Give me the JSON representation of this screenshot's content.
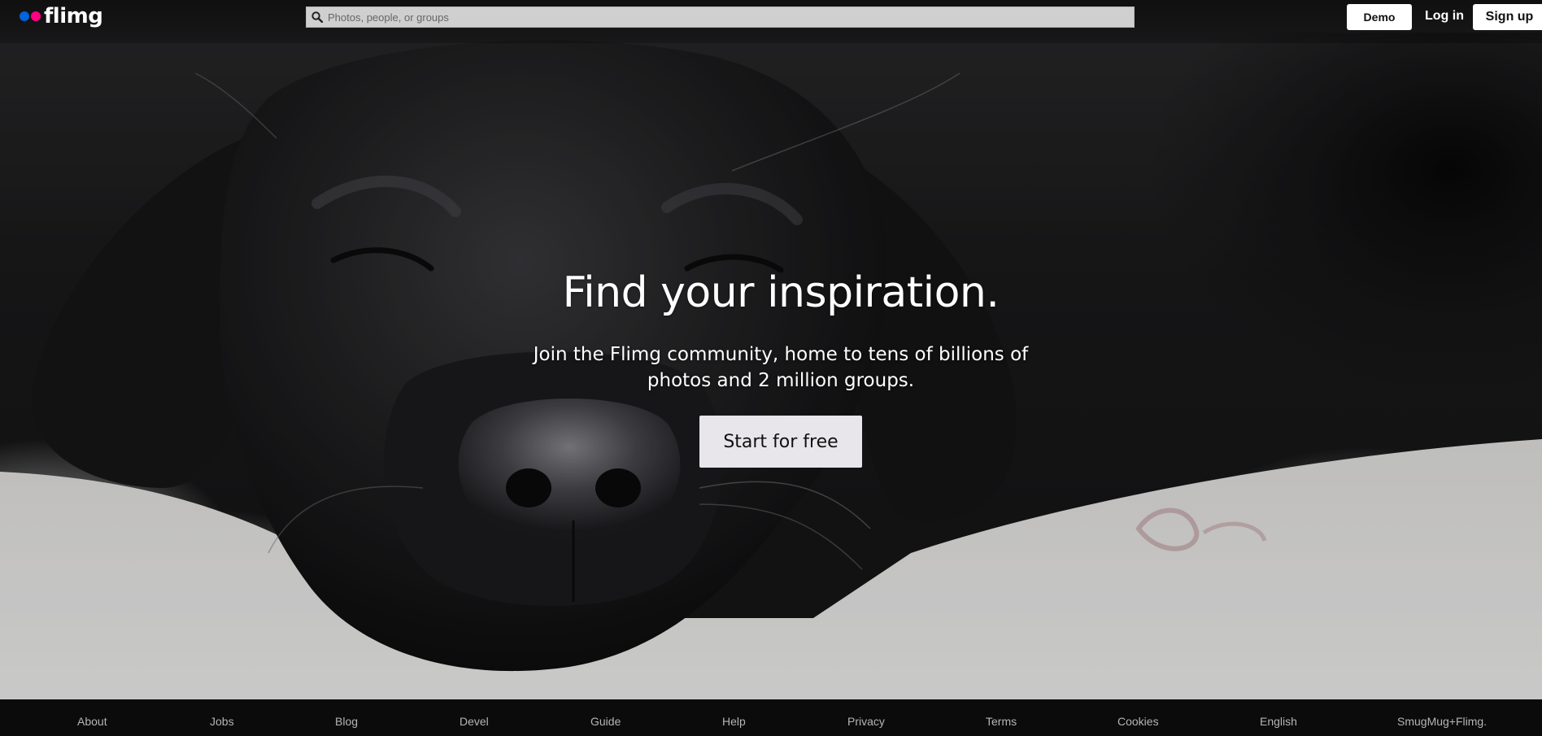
{
  "brand": {
    "name": "flimg",
    "dot_colors": [
      "#0063dc",
      "#ff0084"
    ]
  },
  "search": {
    "placeholder": "Photos, people, or groups",
    "icon": "search-icon"
  },
  "header": {
    "demo_label": "Demo",
    "login_label": "Log in",
    "signup_label": "Sign up"
  },
  "hero": {
    "title": "Find your inspiration.",
    "subtitle": "Join the Flimg community, home to tens of billions of photos and 2 million groups.",
    "cta_label": "Start for free"
  },
  "footer": {
    "links": [
      "About",
      "Jobs",
      "Blog",
      "Devel",
      "Guide",
      "Help",
      "Privacy",
      "Terms",
      "Cookies",
      "English",
      "SmugMug+Flimg."
    ]
  }
}
